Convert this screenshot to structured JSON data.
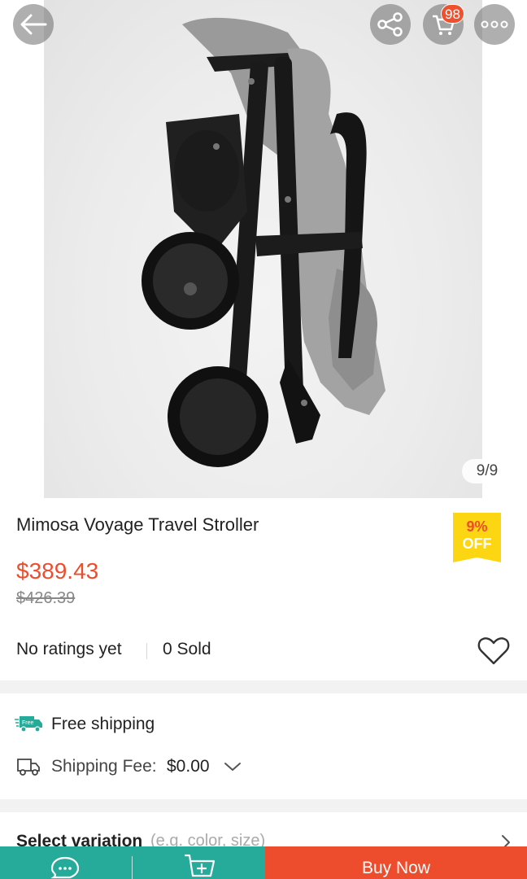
{
  "header": {
    "cart_badge": "98",
    "image_counter": "9/9",
    "icons": [
      "back-arrow-icon",
      "share-icon",
      "cart-icon",
      "more-icon"
    ]
  },
  "product": {
    "title": "Mimosa Voyage Travel Stroller",
    "discount_pct": "9%",
    "discount_off": "OFF",
    "price": "$389.43",
    "original_price": "$426.39",
    "ratings_text": "No ratings yet",
    "sold_text": "0 Sold"
  },
  "shipping": {
    "free_badge": "Free",
    "free_label": "Free shipping",
    "fee_label": "Shipping Fee:",
    "fee_value": "$0.00"
  },
  "variation": {
    "label": "Select variation",
    "hint": "(e.g. color, size)"
  },
  "bottom_bar": {
    "buy_now": "Buy Now"
  },
  "colors": {
    "accent": "#ee4d2d",
    "teal": "#26aa99",
    "discount_yellow": "#fcd513"
  }
}
